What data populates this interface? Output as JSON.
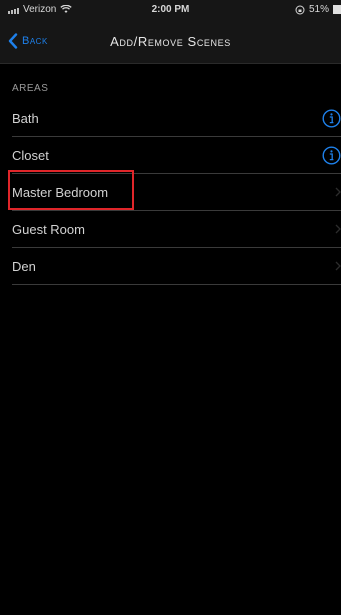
{
  "status_bar": {
    "carrier": "Verizon",
    "time": "2:00 PM",
    "battery": "51%"
  },
  "nav": {
    "back_label": "Back",
    "title": "Add/Remove Scenes"
  },
  "areas": {
    "header": "AREAS",
    "items": [
      {
        "label": "Bath",
        "accessory": "info-icon"
      },
      {
        "label": "Closet",
        "accessory": "info-icon"
      },
      {
        "label": "Master Bedroom",
        "accessory": "chevron-right-icon"
      },
      {
        "label": "Guest Room",
        "accessory": "chevron-right-icon"
      },
      {
        "label": "Den",
        "accessory": "chevron-right-icon"
      }
    ]
  },
  "colors": {
    "accent": "#1e80ea",
    "background": "#000000",
    "highlight": "#e0262a"
  }
}
